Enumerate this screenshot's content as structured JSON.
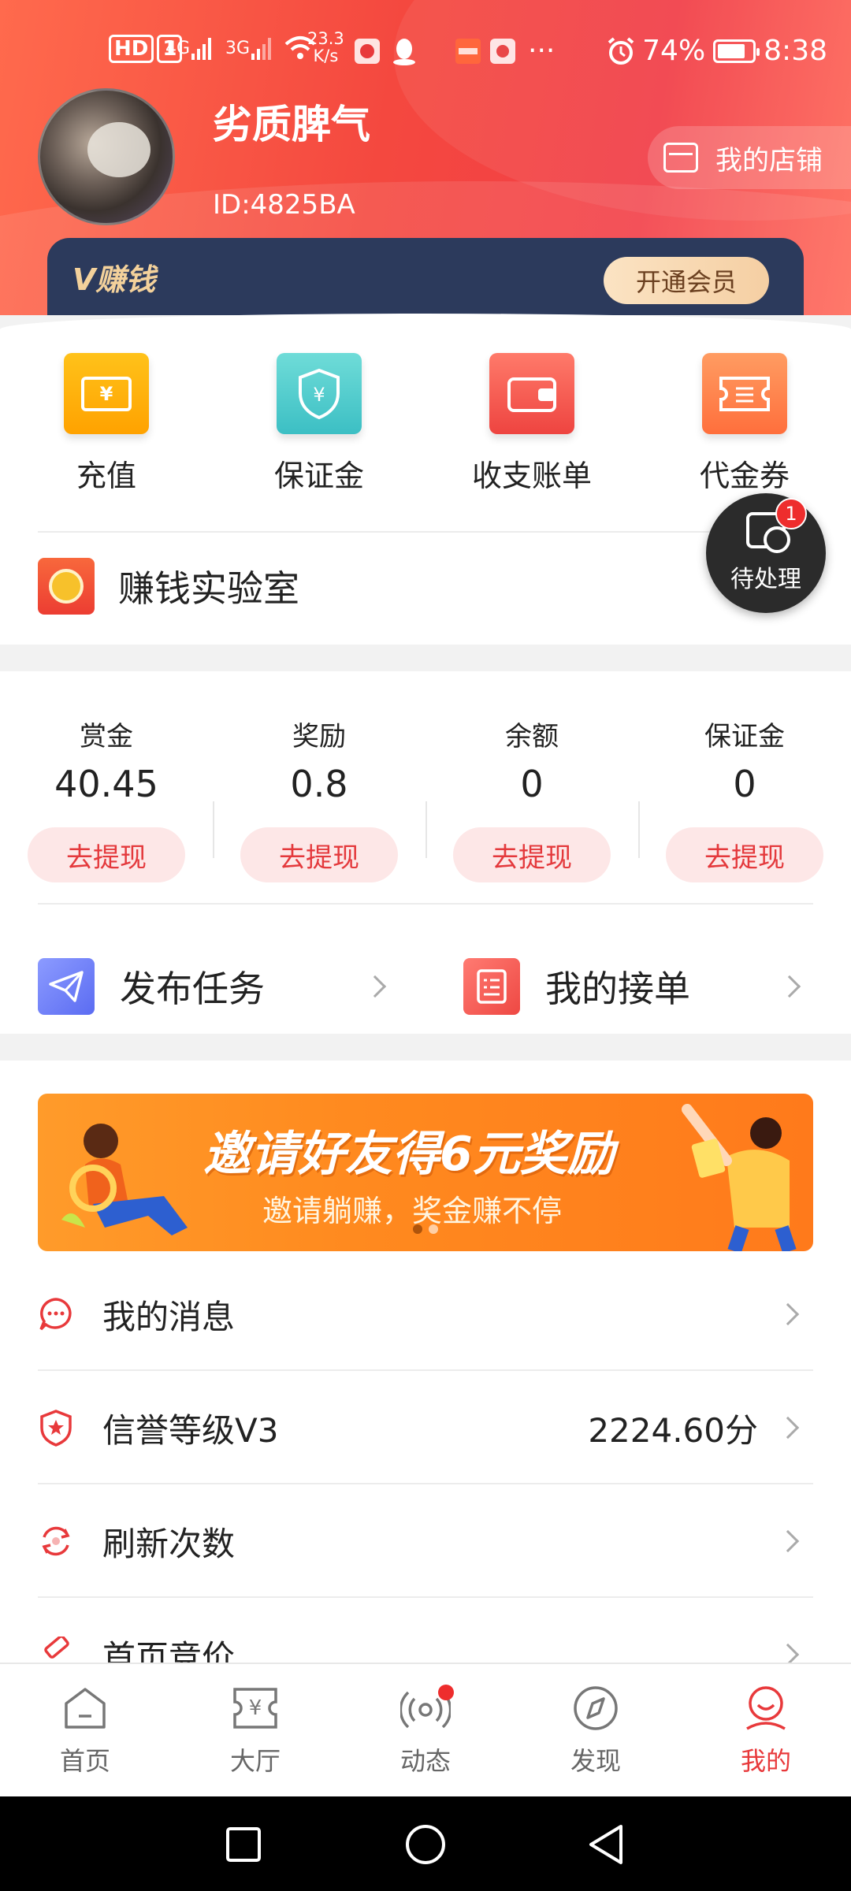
{
  "status_bar": {
    "hd_label": "HD",
    "sim_label": "1",
    "net1": "4G",
    "net2": "3G",
    "speed_value": "23.3",
    "speed_unit": "K/s",
    "more": "···",
    "battery_percent": "74%",
    "time": "8:38"
  },
  "profile": {
    "username": "劣质脾气",
    "user_id": "ID:4825BA",
    "shop_button": "我的店铺"
  },
  "vip": {
    "logo_letter": "V",
    "logo_text": "赚钱",
    "cta": "开通会员"
  },
  "quick_actions": [
    {
      "label": "充值",
      "icon": "recharge-icon",
      "color": "#ffb400"
    },
    {
      "label": "保证金",
      "icon": "deposit-shield-icon",
      "color": "#4fc9c9"
    },
    {
      "label": "收支账单",
      "icon": "wallet-icon",
      "color": "#f4564d"
    },
    {
      "label": "代金券",
      "icon": "coupon-icon",
      "color": "#ff7b4a"
    }
  ],
  "lab": {
    "label": "赚钱实验室"
  },
  "pending": {
    "label": "待处理",
    "badge": "1"
  },
  "balances": [
    {
      "name": "赏金",
      "value": "40.45",
      "button": "去提现"
    },
    {
      "name": "奖励",
      "value": "0.8",
      "button": "去提现"
    },
    {
      "name": "余额",
      "value": "0",
      "button": "去提现"
    },
    {
      "name": "保证金",
      "value": "0",
      "button": "去提现"
    }
  ],
  "tasks": {
    "publish": "发布任务",
    "my_orders": "我的接单"
  },
  "banner": {
    "title": "邀请好友得6元奖励",
    "subtitle": "邀请躺赚，奖金赚不停"
  },
  "menu": [
    {
      "label": "我的消息",
      "value": "",
      "icon": "message-icon"
    },
    {
      "label": "信誉等级V3",
      "value": "2224.60分",
      "icon": "credit-shield-icon"
    },
    {
      "label": "刷新次数",
      "value": "",
      "icon": "refresh-icon"
    },
    {
      "label": "首页竞价",
      "value": "",
      "icon": "bid-icon"
    }
  ],
  "nav": [
    {
      "label": "首页",
      "icon": "home-icon"
    },
    {
      "label": "大厅",
      "icon": "hall-icon"
    },
    {
      "label": "动态",
      "icon": "activity-icon"
    },
    {
      "label": "发现",
      "icon": "discover-compass-icon"
    },
    {
      "label": "我的",
      "icon": "profile-icon",
      "active": true
    }
  ],
  "colors": {
    "accent": "#e8393b",
    "header": "#f4483f",
    "vip_bg": "#2c3a5c"
  }
}
